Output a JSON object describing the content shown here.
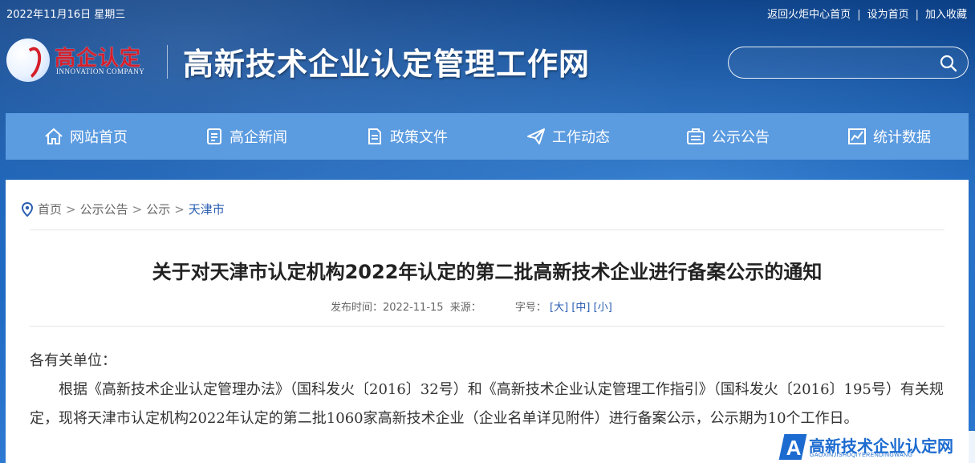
{
  "topbar": {
    "date": "2022年11月16日 星期三",
    "links": [
      "返回火炬中心首页",
      "设为首页",
      "加入收藏"
    ]
  },
  "logo": {
    "cn": "高企认定",
    "en": "INNOVATION COMPANY"
  },
  "site_title": "高新技术企业认定管理工作网",
  "search": {
    "value": "",
    "placeholder": ""
  },
  "nav": {
    "items": [
      {
        "label": "网站首页",
        "icon": "home-icon"
      },
      {
        "label": "高企新闻",
        "icon": "news-icon"
      },
      {
        "label": "政策文件",
        "icon": "document-icon"
      },
      {
        "label": "工作动态",
        "icon": "send-icon"
      },
      {
        "label": "公示公告",
        "icon": "notice-icon"
      },
      {
        "label": "统计数据",
        "icon": "chart-icon"
      }
    ]
  },
  "breadcrumb": [
    "首页",
    "公示公告",
    "公示",
    "天津市"
  ],
  "article": {
    "title": "关于对天津市认定机构2022年认定的第二批高新技术企业进行备案公示的通知",
    "publish_label": "发布时间：",
    "publish_date": "2022-11-15",
    "source_label": "来源：",
    "font_size_label": "字号：",
    "font_sizes": [
      "[大]",
      "[中]",
      "[小]"
    ],
    "salutation": "各有关单位：",
    "paragraph": "根据《高新技术企业认定管理办法》（国科发火〔2016〕32号）和《高新技术企业认定管理工作指引》（国科发火〔2016〕195号）有关规定，现将天津市认定机构2022年认定的第二批1060家高新技术企业（企业名单详见附件）进行备案公示，公示期为10个工作日。"
  },
  "watermark": {
    "cn": "高新技术企业认定网",
    "en": "GAOXINJISHUQIYERENDINGWANG"
  },
  "colors": {
    "header_blue": "#1763bd",
    "nav_blue": "#5b9be0",
    "link_blue": "#2a5eb3",
    "logo_red": "#d51f2b"
  }
}
